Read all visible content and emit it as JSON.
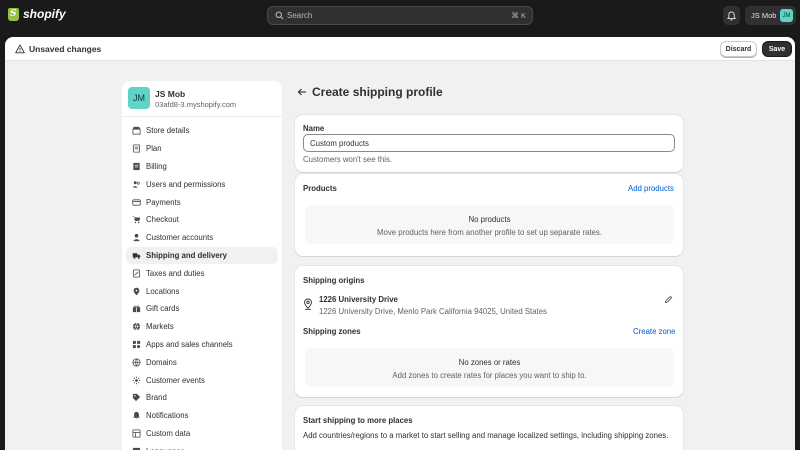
{
  "topbar": {
    "brand": "shopify",
    "search_placeholder": "Search",
    "search_shortcut": "⌘ K",
    "user_name": "JS Mob",
    "user_initials": "JM"
  },
  "unsaved_bar": {
    "message": "Unsaved changes",
    "discard_label": "Discard",
    "save_label": "Save"
  },
  "sidebar": {
    "store_initials": "JM",
    "store_name": "JS Mob",
    "store_domain": "03afd8-3.myshopify.com",
    "items": [
      {
        "label": "Store details",
        "icon": "store-icon"
      },
      {
        "label": "Plan",
        "icon": "plan-icon"
      },
      {
        "label": "Billing",
        "icon": "billing-icon"
      },
      {
        "label": "Users and permissions",
        "icon": "users-icon"
      },
      {
        "label": "Payments",
        "icon": "payments-icon"
      },
      {
        "label": "Checkout",
        "icon": "cart-icon"
      },
      {
        "label": "Customer accounts",
        "icon": "person-icon"
      },
      {
        "label": "Shipping and delivery",
        "icon": "truck-icon"
      },
      {
        "label": "Taxes and duties",
        "icon": "taxes-icon"
      },
      {
        "label": "Locations",
        "icon": "location-icon"
      },
      {
        "label": "Gift cards",
        "icon": "gift-icon"
      },
      {
        "label": "Markets",
        "icon": "globe-icon"
      },
      {
        "label": "Apps and sales channels",
        "icon": "apps-icon"
      },
      {
        "label": "Domains",
        "icon": "domain-icon"
      },
      {
        "label": "Customer events",
        "icon": "events-icon"
      },
      {
        "label": "Brand",
        "icon": "brand-icon"
      },
      {
        "label": "Notifications",
        "icon": "bell-icon"
      },
      {
        "label": "Custom data",
        "icon": "data-icon"
      },
      {
        "label": "Languages",
        "icon": "language-icon"
      }
    ],
    "active_index": 7
  },
  "page": {
    "title": "Create shipping profile"
  },
  "name_card": {
    "label": "Name",
    "value": "Custom products",
    "help": "Customers won't see this."
  },
  "products_card": {
    "title": "Products",
    "action": "Add products",
    "empty_title": "No products",
    "empty_sub": "Move products here from another profile to set up separate rates."
  },
  "origins_card": {
    "title": "Shipping origins",
    "address_title": "1226 University Drive",
    "address_full": "1226 University Drive, Menlo Park California 94025, United States",
    "zones_title": "Shipping zones",
    "zones_action": "Create zone",
    "empty_title": "No zones or rates",
    "empty_sub": "Add zones to create rates for places you want to ship to."
  },
  "more_card": {
    "title": "Start shipping to more places",
    "body": "Add countries/regions to a market to start selling and manage localized settings, including shipping zones."
  },
  "colors": {
    "accent_link": "#005bd3",
    "avatar": "#5ed3c6",
    "topbar": "#1a1a1a",
    "canvas": "#f1f1f1"
  }
}
